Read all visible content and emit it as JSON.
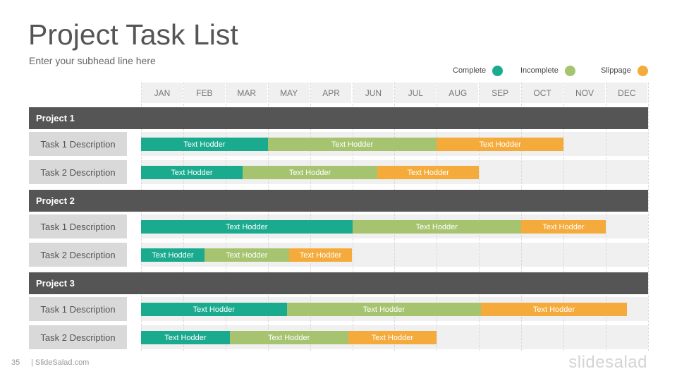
{
  "title": "Project Task List",
  "subtitle": "Enter your subhead line here",
  "legend": [
    {
      "label": "Complete",
      "color": "#1aab8f"
    },
    {
      "label": "Incomplete",
      "color": "#a6c46f"
    },
    {
      "label": "Slippage",
      "color": "#f4ab3c"
    }
  ],
  "chart_data": {
    "type": "gantt",
    "months": [
      "JAN",
      "FEB",
      "MAR",
      "MAY",
      "APR",
      "JUN",
      "JUL",
      "AUG",
      "SEP",
      "OCT",
      "NOV",
      "DEC"
    ],
    "statuses": [
      "Complete",
      "Incomplete",
      "Slippage"
    ],
    "colors": {
      "Complete": "#1aab8f",
      "Incomplete": "#a6c46f",
      "Slippage": "#f4ab3c"
    },
    "projects": [
      {
        "name": "Project 1",
        "tasks": [
          {
            "label": "Task 1 Description",
            "segments": [
              {
                "status": "Complete",
                "start": 0,
                "end": 3,
                "text": "Text Hodder"
              },
              {
                "status": "Incomplete",
                "start": 3,
                "end": 7,
                "text": "Text Hodder"
              },
              {
                "status": "Slippage",
                "start": 7,
                "end": 10,
                "text": "Text Hodder"
              }
            ]
          },
          {
            "label": "Task 2 Description",
            "segments": [
              {
                "status": "Complete",
                "start": 0,
                "end": 2.4,
                "text": "Text Hodder"
              },
              {
                "status": "Incomplete",
                "start": 2.4,
                "end": 5.6,
                "text": "Text Hodder"
              },
              {
                "status": "Slippage",
                "start": 5.6,
                "end": 8,
                "text": "Text Hodder"
              }
            ]
          }
        ]
      },
      {
        "name": "Project 2",
        "tasks": [
          {
            "label": "Task 1 Description",
            "segments": [
              {
                "status": "Complete",
                "start": 0,
                "end": 5,
                "text": "Text Hodder"
              },
              {
                "status": "Incomplete",
                "start": 5,
                "end": 9,
                "text": "Text Hodder"
              },
              {
                "status": "Slippage",
                "start": 9,
                "end": 11,
                "text": "Text Hodder"
              }
            ]
          },
          {
            "label": "Task 2 Description",
            "segments": [
              {
                "status": "Complete",
                "start": 0,
                "end": 1.5,
                "text": "Text Hodder"
              },
              {
                "status": "Incomplete",
                "start": 1.5,
                "end": 3.5,
                "text": "Text Hodder"
              },
              {
                "status": "Slippage",
                "start": 3.5,
                "end": 5,
                "text": "Text Hodder"
              }
            ]
          }
        ]
      },
      {
        "name": "Project 3",
        "tasks": [
          {
            "label": "Task 1 Description",
            "segments": [
              {
                "status": "Complete",
                "start": 0,
                "end": 3.45,
                "text": "Text Hodder"
              },
              {
                "status": "Incomplete",
                "start": 3.45,
                "end": 8.05,
                "text": "Text Hodder"
              },
              {
                "status": "Slippage",
                "start": 8.05,
                "end": 11.5,
                "text": "Text Hodder"
              }
            ]
          },
          {
            "label": "Task 2 Description",
            "segments": [
              {
                "status": "Complete",
                "start": 0,
                "end": 2.1,
                "text": "Text Hodder"
              },
              {
                "status": "Incomplete",
                "start": 2.1,
                "end": 4.9,
                "text": "Text Hodder"
              },
              {
                "status": "Slippage",
                "start": 4.9,
                "end": 7,
                "text": "Text Hodder"
              }
            ]
          }
        ]
      }
    ]
  },
  "footer": {
    "page_number": "35",
    "site": "| SlideSalad.com",
    "logo": "slidesalad"
  }
}
